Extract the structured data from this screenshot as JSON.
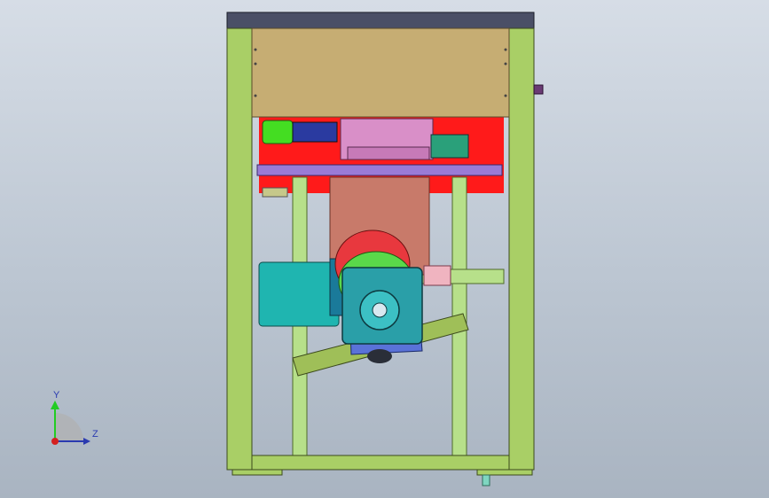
{
  "viewport": {
    "background_top": "#d6dde6",
    "background_bottom": "#a9b4c1"
  },
  "model": {
    "colors": {
      "frame_green": "#a9cf66",
      "frame_edge": "#3c4a1c",
      "top_cap": "#4a4f66",
      "panel_tan": "#c6ad73",
      "red_plate": "#ff1a1a",
      "purple_bar": "#9a7bd6",
      "salmon_hopper": "#c87a6a",
      "pink_gearbox": "#d98fc8",
      "cyan_motor": "#1fb5b0",
      "blue_gearbox": "#2a9fa8",
      "blue_mount": "#5a72d8",
      "olive_rail": "#9fbf58",
      "light_green_rails": "#b7e08a",
      "bright_green_motor": "#44dd22",
      "knob_purple": "#6a3a74"
    }
  },
  "triad": {
    "y_label": "Y",
    "z_label": "Z",
    "y_color": "#22cc22",
    "z_color": "#2a3ab0",
    "x_color": "#d42020"
  }
}
